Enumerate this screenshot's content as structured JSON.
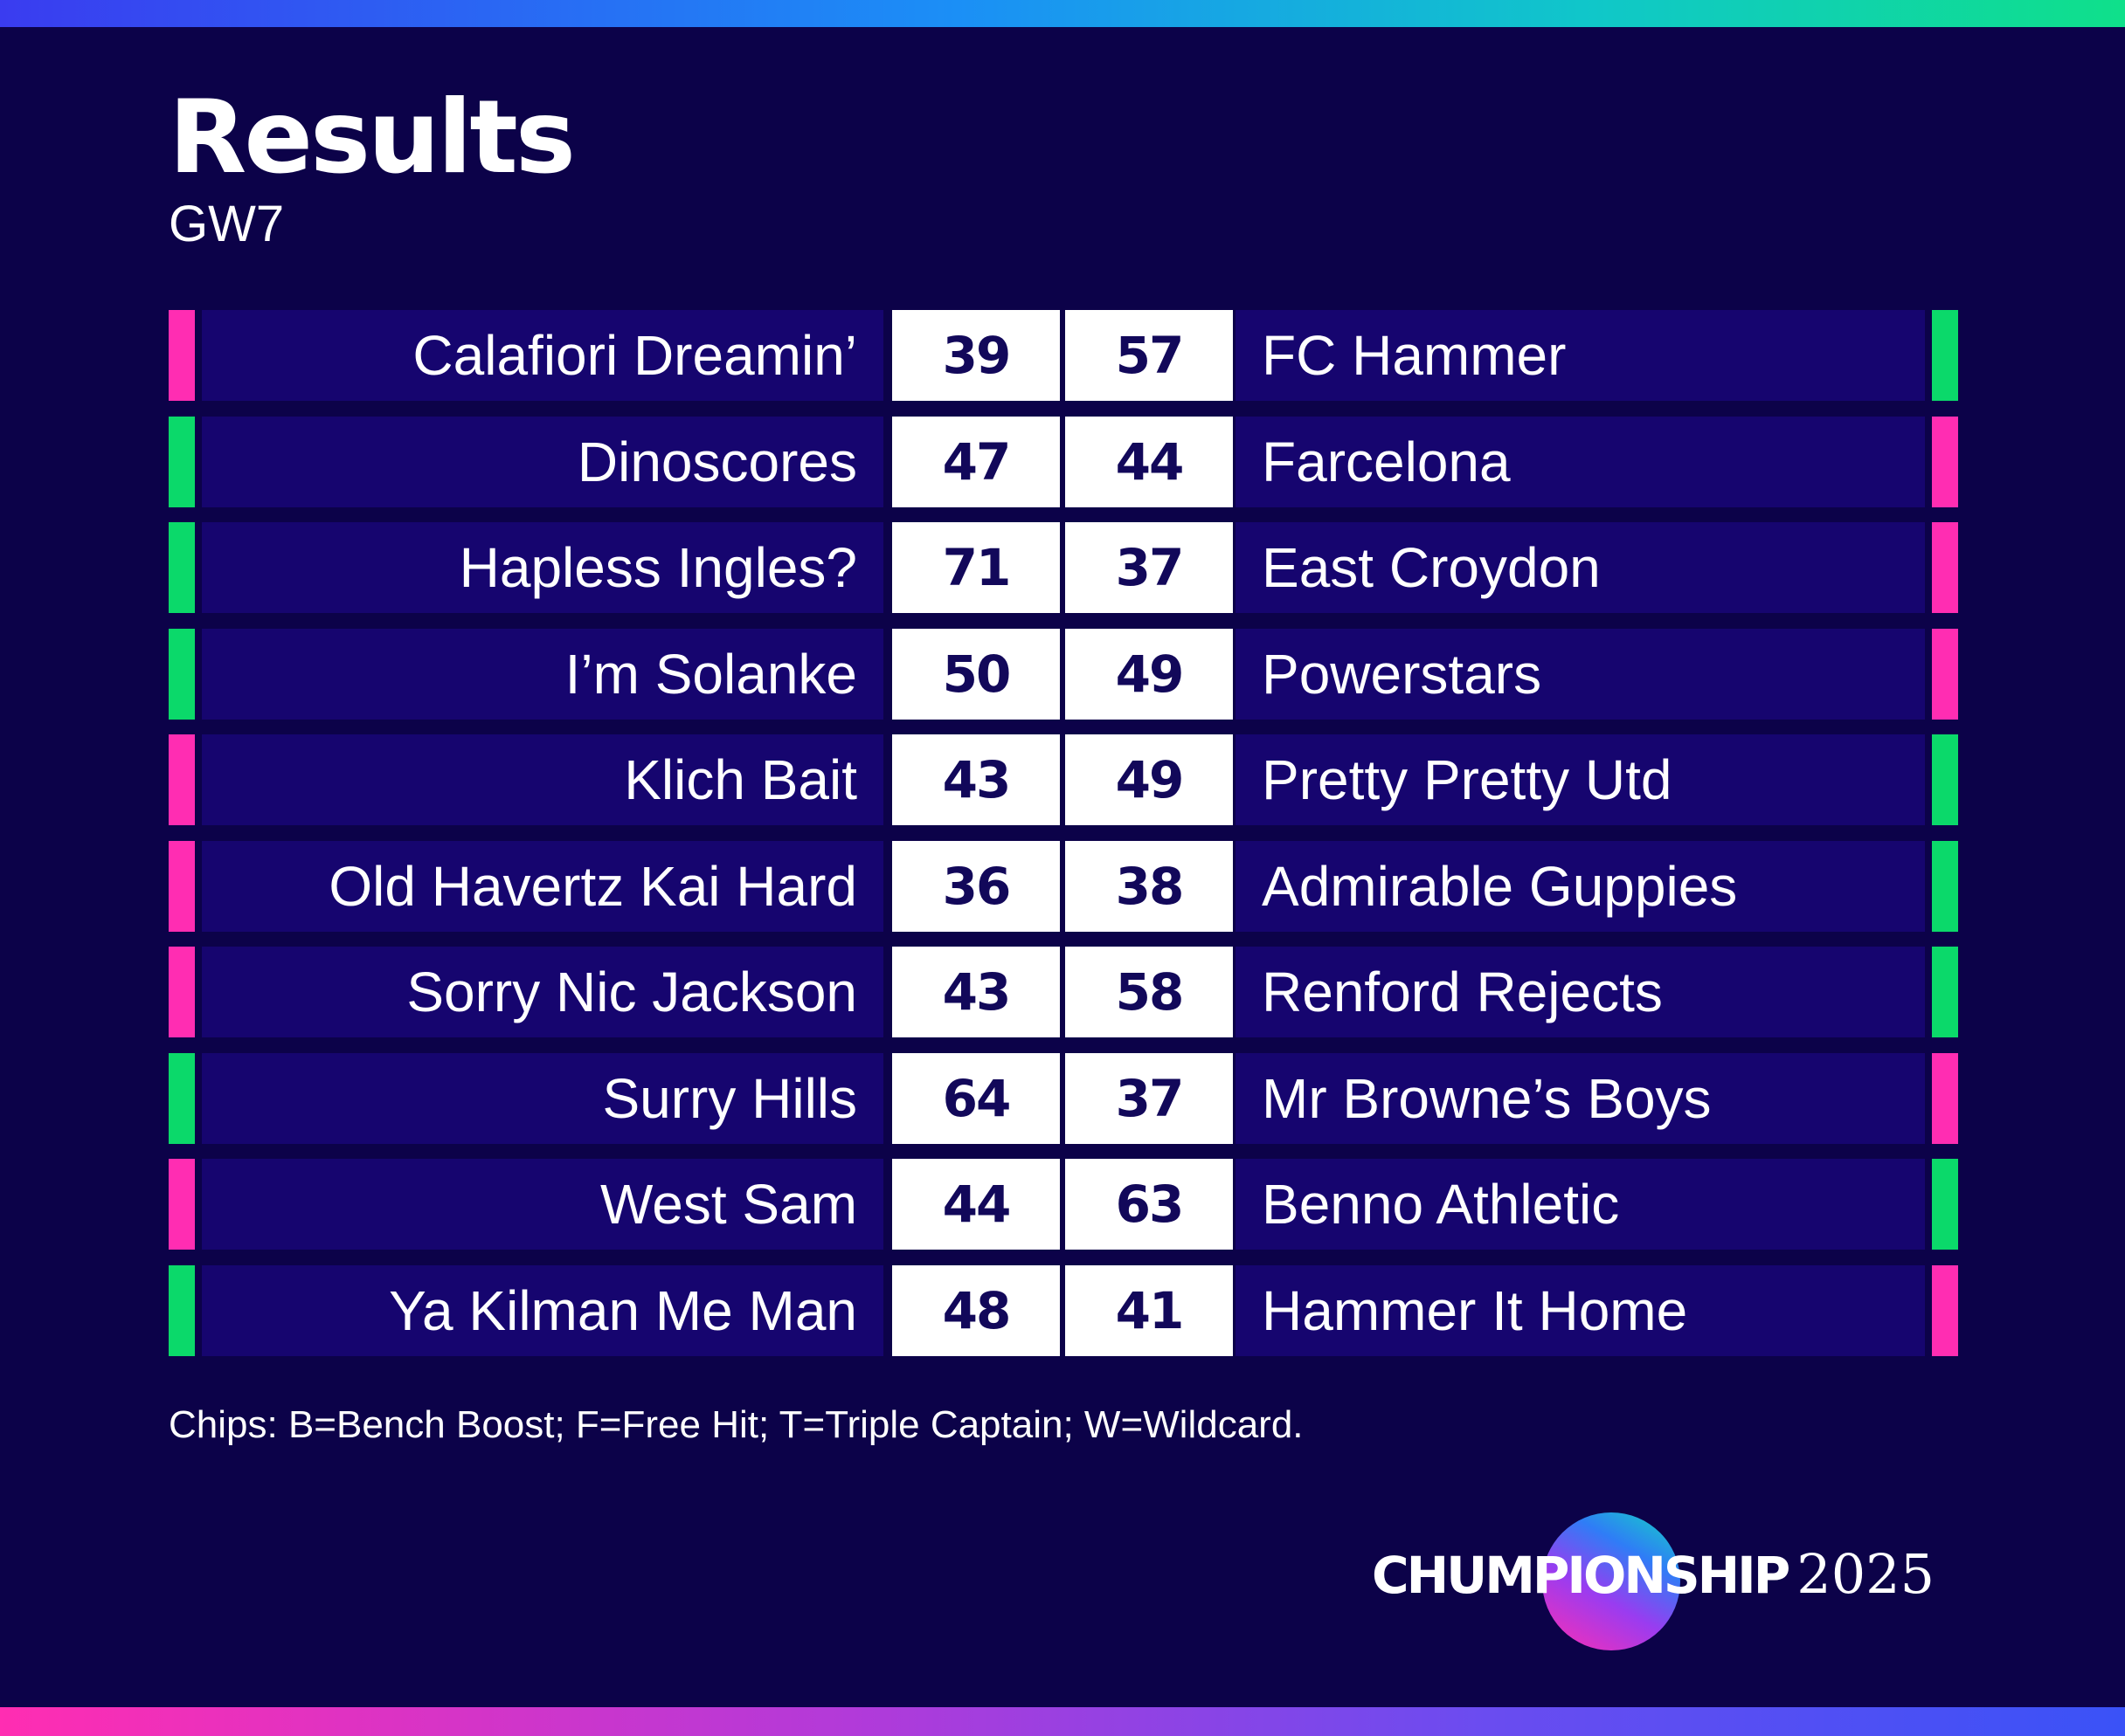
{
  "header": {
    "title": "Results",
    "subtitle": "GW7"
  },
  "colors": {
    "win": "#0bd96a",
    "loss": "#ff2db2",
    "background": "#0c0249",
    "row": "#16056f"
  },
  "matches": [
    {
      "home": "Calafiori Dreamin’",
      "home_score": "39",
      "away_score": "57",
      "away": "FC Hammer",
      "home_result": "loss",
      "away_result": "win"
    },
    {
      "home": "Dinoscores",
      "home_score": "47",
      "away_score": "44",
      "away": "Farcelona",
      "home_result": "win",
      "away_result": "loss"
    },
    {
      "home": "Hapless Ingles?",
      "home_score": "71",
      "away_score": "37",
      "away": "East Croydon",
      "home_result": "win",
      "away_result": "loss"
    },
    {
      "home": "I’m Solanke",
      "home_score": "50",
      "away_score": "49",
      "away": "Powerstars",
      "home_result": "win",
      "away_result": "loss"
    },
    {
      "home": "Klich Bait",
      "home_score": "43",
      "away_score": "49",
      "away": "Pretty Pretty Utd",
      "home_result": "loss",
      "away_result": "win"
    },
    {
      "home": "Old Havertz Kai Hard",
      "home_score": "36",
      "away_score": "38",
      "away": "Admirable Guppies",
      "home_result": "loss",
      "away_result": "win"
    },
    {
      "home": "Sorry Nic Jackson",
      "home_score": "43",
      "away_score": "58",
      "away": "Renford Rejects",
      "home_result": "loss",
      "away_result": "win"
    },
    {
      "home": "Surry Hills",
      "home_score": "64",
      "away_score": "37",
      "away": "Mr Browne’s Boys",
      "home_result": "win",
      "away_result": "loss"
    },
    {
      "home": "West Sam",
      "home_score": "44",
      "away_score": "63",
      "away": "Benno Athletic",
      "home_result": "loss",
      "away_result": "win"
    },
    {
      "home": "Ya Kilman Me Man",
      "home_score": "48",
      "away_score": "41",
      "away": "Hammer It Home",
      "home_result": "win",
      "away_result": "loss"
    }
  ],
  "footnote": "Chips: B=Bench Boost; F=Free Hit; T=Triple Captain; W=Wildcard.",
  "brand": {
    "word": "CHUMPIONSHIP",
    "year": "2025"
  }
}
